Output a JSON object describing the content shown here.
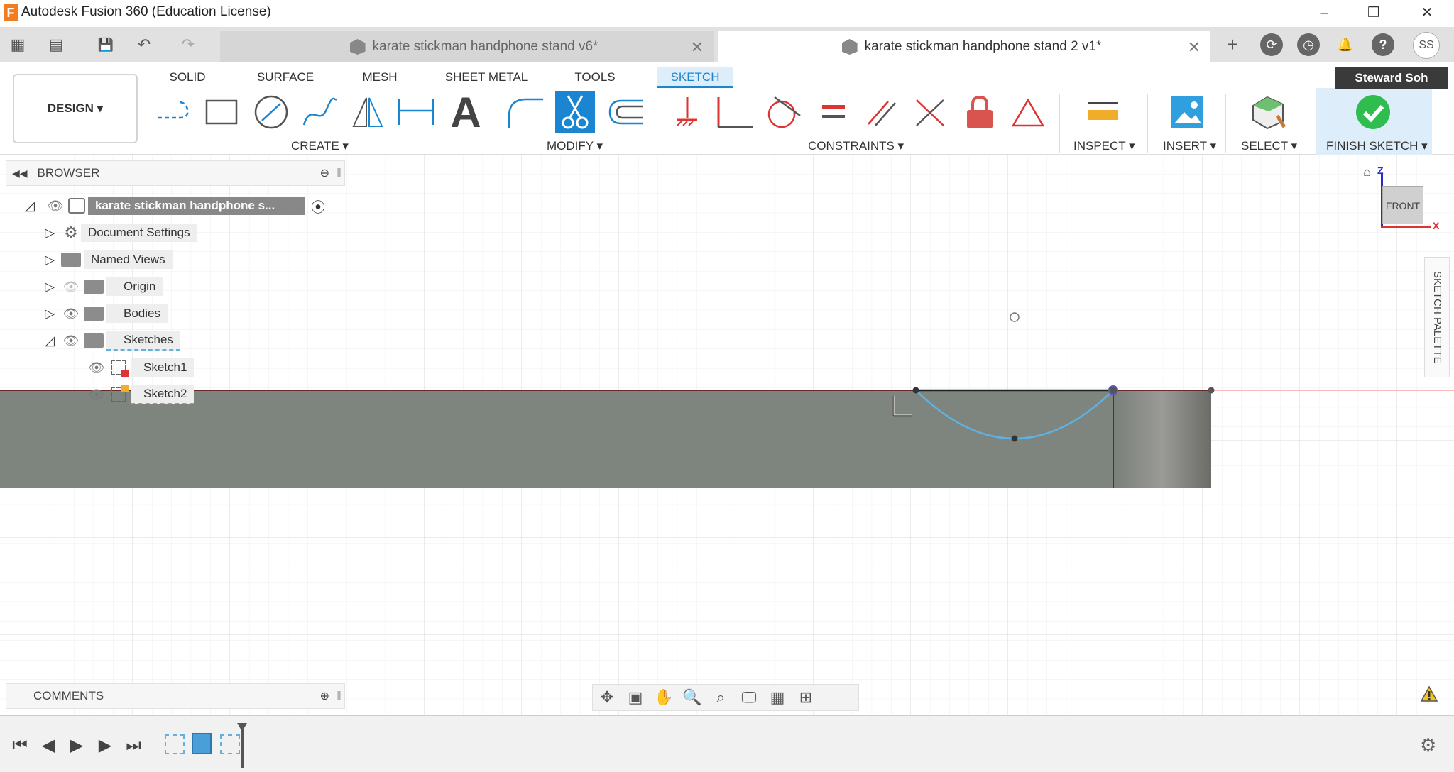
{
  "window": {
    "title": "Autodesk Fusion 360 (Education License)",
    "logo_letter": "F",
    "minimize_icon": "–",
    "restore_icon": "❐",
    "close_icon": "✕"
  },
  "tabs": [
    {
      "label": "karate stickman handphone stand v6*",
      "active": false,
      "close": "✕"
    },
    {
      "label": "karate stickman handphone stand 2 v1*",
      "active": true,
      "close": "✕"
    }
  ],
  "quick_icons": {
    "grid": "▦",
    "file": "▤",
    "save": "💾",
    "undo": "↶",
    "redo": "↷"
  },
  "right_icons": {
    "new_tab": "+",
    "extensions": "⟳",
    "job_status": "◷",
    "notifications": "🔔",
    "help": "?"
  },
  "user": {
    "initials": "SS",
    "name": "Steward Soh"
  },
  "ribbon": {
    "workspace": "DESIGN ▾",
    "tabs": [
      "SOLID",
      "SURFACE",
      "MESH",
      "SHEET METAL",
      "TOOLS",
      "SKETCH"
    ],
    "active_tab": "SKETCH",
    "groups": {
      "create": "CREATE ▾",
      "modify": "MODIFY ▾",
      "constraints": "CONSTRAINTS ▾",
      "inspect": "INSPECT ▾",
      "insert": "INSERT ▾",
      "select": "SELECT ▾",
      "finish": "FINISH SKETCH ▾"
    }
  },
  "browser": {
    "title": "BROWSER",
    "root": "karate stickman handphone s...",
    "items": [
      {
        "label": "Document Settings"
      },
      {
        "label": "Named Views"
      },
      {
        "label": "Origin"
      },
      {
        "label": "Bodies"
      },
      {
        "label": "Sketches"
      },
      {
        "label": "Sketch1"
      },
      {
        "label": "Sketch2"
      }
    ]
  },
  "comments": {
    "title": "COMMENTS"
  },
  "viewcube": {
    "face": "FRONT",
    "axis_z": "Z",
    "axis_x": "X"
  },
  "sketch_palette": {
    "label": "SKETCH PALETTE"
  },
  "colors": {
    "accent": "#1a85d0",
    "body": "#7e847e",
    "arc": "#5fb1e0"
  }
}
